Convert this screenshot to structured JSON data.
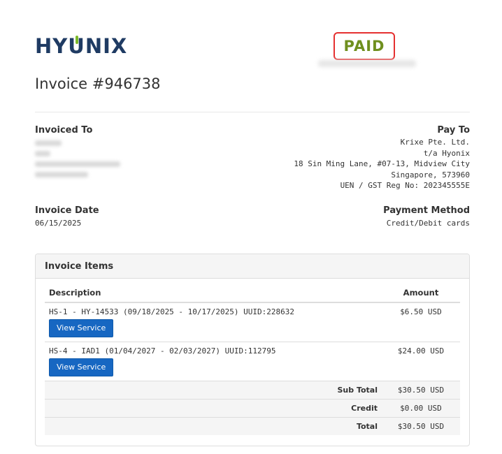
{
  "logo": {
    "text_pre": "HY",
    "text_u": "U",
    "text_post": "NIX"
  },
  "status": {
    "label": "PAID",
    "color": "#6f8f1e",
    "border_color": "#e53030"
  },
  "invoice": {
    "title": "Invoice #946738"
  },
  "invoiced_to": {
    "label": "Invoiced To"
  },
  "pay_to": {
    "label": "Pay To",
    "lines": [
      "Krixe Pte. Ltd.",
      "t/a Hyonix",
      "18 Sin Ming Lane, #07-13, Midview City",
      "Singapore, 573960",
      "UEN / GST Reg No: 202345555E"
    ]
  },
  "invoice_date": {
    "label": "Invoice Date",
    "value": "06/15/2025"
  },
  "payment_method": {
    "label": "Payment Method",
    "value": "Credit/Debit cards"
  },
  "items": {
    "header": "Invoice Items",
    "col_description": "Description",
    "col_amount": "Amount",
    "rows": [
      {
        "description": "HS-1 - HY-14533 (09/18/2025 - 10/17/2025) UUID:228632",
        "button": "View Service",
        "amount": "$6.50 USD"
      },
      {
        "description": "HS-4 - IAD1 (01/04/2027 - 02/03/2027) UUID:112795",
        "button": "View Service",
        "amount": "$24.00 USD"
      }
    ],
    "subtotal_label": "Sub Total",
    "subtotal_value": "$30.50 USD",
    "credit_label": "Credit",
    "credit_value": "$0.00 USD",
    "total_label": "Total",
    "total_value": "$30.50 USD"
  },
  "colors": {
    "button": "#1767c2",
    "brand": "#1f3b63",
    "brand_accent": "#7cb928"
  }
}
